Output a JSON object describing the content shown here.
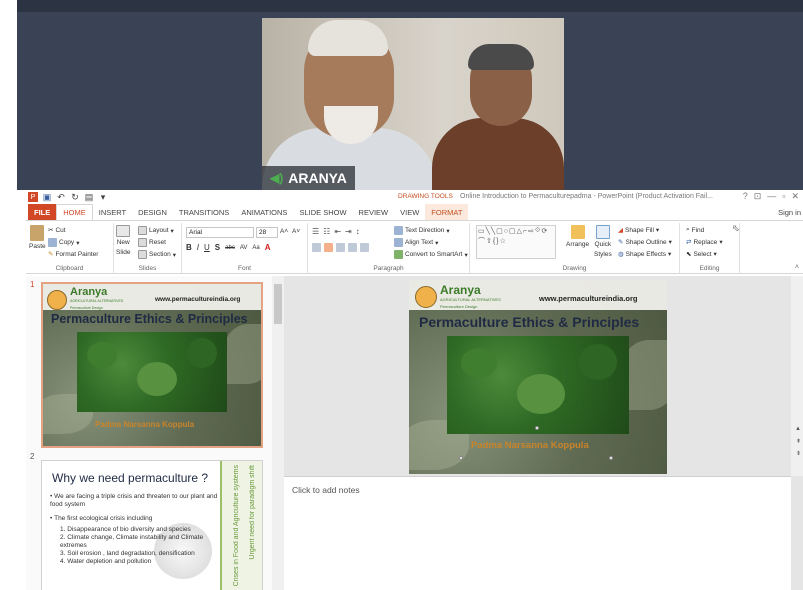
{
  "video": {
    "participant_name": "ARANYA"
  },
  "window": {
    "context_tab": "DRAWING TOOLS",
    "title": "Online Introduction to Permaculturepadma - PowerPoint (Product Activation Fail...",
    "controls": [
      "?",
      "⊡",
      "—",
      "▫",
      "✕"
    ]
  },
  "tabs": [
    {
      "label": "FILE",
      "kind": "file"
    },
    {
      "label": "HOME",
      "kind": "active"
    },
    {
      "label": "INSERT",
      "kind": ""
    },
    {
      "label": "DESIGN",
      "kind": ""
    },
    {
      "label": "TRANSITIONS",
      "kind": ""
    },
    {
      "label": "ANIMATIONS",
      "kind": ""
    },
    {
      "label": "SLIDE SHOW",
      "kind": ""
    },
    {
      "label": "REVIEW",
      "kind": ""
    },
    {
      "label": "VIEW",
      "kind": ""
    },
    {
      "label": "FORMAT",
      "kind": "format"
    }
  ],
  "signin": "Sign in",
  "ribbon": {
    "clipboard": {
      "label": "Clipboard",
      "paste": "Paste",
      "cut": "Cut",
      "copy": "Copy",
      "format_painter": "Format Painter"
    },
    "slides": {
      "label": "Slides",
      "new_slide": "New",
      "new_slide2": "Slide",
      "layout": "Layout",
      "reset": "Reset",
      "section": "Section"
    },
    "font": {
      "label": "Font",
      "family": "Arial",
      "size": "28",
      "bold": "B",
      "italic": "I",
      "underline": "U",
      "shadow": "S",
      "strike": "abc",
      "spacing": "AV",
      "case": "Aa"
    },
    "paragraph": {
      "label": "Paragraph",
      "text_direction": "Text Direction",
      "align_text": "Align Text",
      "convert_smartart": "Convert to SmartArt"
    },
    "drawing": {
      "label": "Drawing",
      "arrange": "Arrange",
      "quick_styles": "Quick",
      "quick_styles2": "Styles",
      "shape_fill": "Shape Fill",
      "shape_outline": "Shape Outline",
      "shape_effects": "Shape Effects"
    },
    "editing": {
      "label": "Editing",
      "find": "Find",
      "replace": "Replace",
      "select": "Select"
    }
  },
  "slides": [
    {
      "number": "1",
      "logo_name": "Aranya",
      "logo_sub": "AGRICULTURAL ALTERNATIVES",
      "logo_tag": "Permaculture Design",
      "url": "www.permacultureindia.org",
      "title": "Permaculture Ethics & Principles",
      "author": "Padma Narsanna Koppula"
    },
    {
      "number": "2",
      "title": "Why we need permaculture ?",
      "bullets": [
        "We are facing  a triple crisis and threaten to our plant and food system",
        "The first ecological crisis including"
      ],
      "numbered": [
        "Disappearance of bio diversity and species",
        "Climate change, Climate instability and Climate extremes",
        "Soil erosion , land degradation, densification",
        "Water depletion and pollution"
      ],
      "side_text_1": "Crises in Food and Agriculture systems",
      "side_text_2": "Urgent need for paradigm shift"
    }
  ],
  "notes": {
    "placeholder": "Click to add notes"
  },
  "colors": {
    "accent": "#d24726",
    "format_tab": "#c44d1e",
    "title_blue": "#1f2a44",
    "author_orange": "#c9842a"
  }
}
